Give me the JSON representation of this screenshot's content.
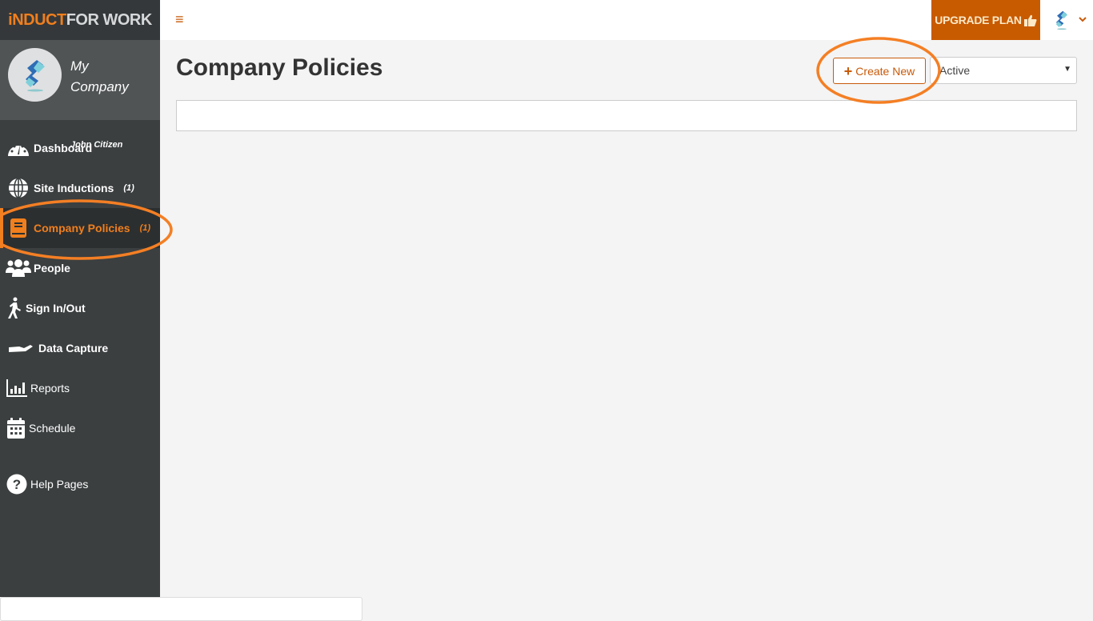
{
  "brand": {
    "part1": "iNDUCT",
    "part2": "FOR WORK"
  },
  "profile": {
    "company": "My Company",
    "user": "John Citizen"
  },
  "sidebar": {
    "items": [
      {
        "label": "Dashboard",
        "icon": "dashboard-gauge-icon",
        "count": ""
      },
      {
        "label": "Site Inductions",
        "icon": "globe-icon",
        "count": "(1)"
      },
      {
        "label": "Company Policies",
        "icon": "book-icon",
        "count": "(1)",
        "active": true
      },
      {
        "label": "People",
        "icon": "users-icon",
        "count": ""
      },
      {
        "label": "Sign In/Out",
        "icon": "walking-person-icon",
        "count": ""
      },
      {
        "label": "Data Capture",
        "icon": "hand-icon",
        "count": ""
      },
      {
        "label": "Reports",
        "icon": "bar-chart-icon",
        "count": ""
      },
      {
        "label": "Schedule",
        "icon": "calendar-icon",
        "count": ""
      },
      {
        "label": "Help Pages",
        "icon": "question-circle-icon",
        "count": ""
      }
    ]
  },
  "topbar": {
    "menu_icon": "≡",
    "upgrade_label": "UPGRADE PLAN",
    "chevron": "⌄"
  },
  "main": {
    "title": "Company Policies",
    "create_label": "Create New",
    "status_filter": {
      "selected": "Active"
    }
  },
  "colors": {
    "accent": "#f07f1d",
    "upgrade_bg": "#c85a00",
    "sidebar_bg": "#3b3f40"
  }
}
